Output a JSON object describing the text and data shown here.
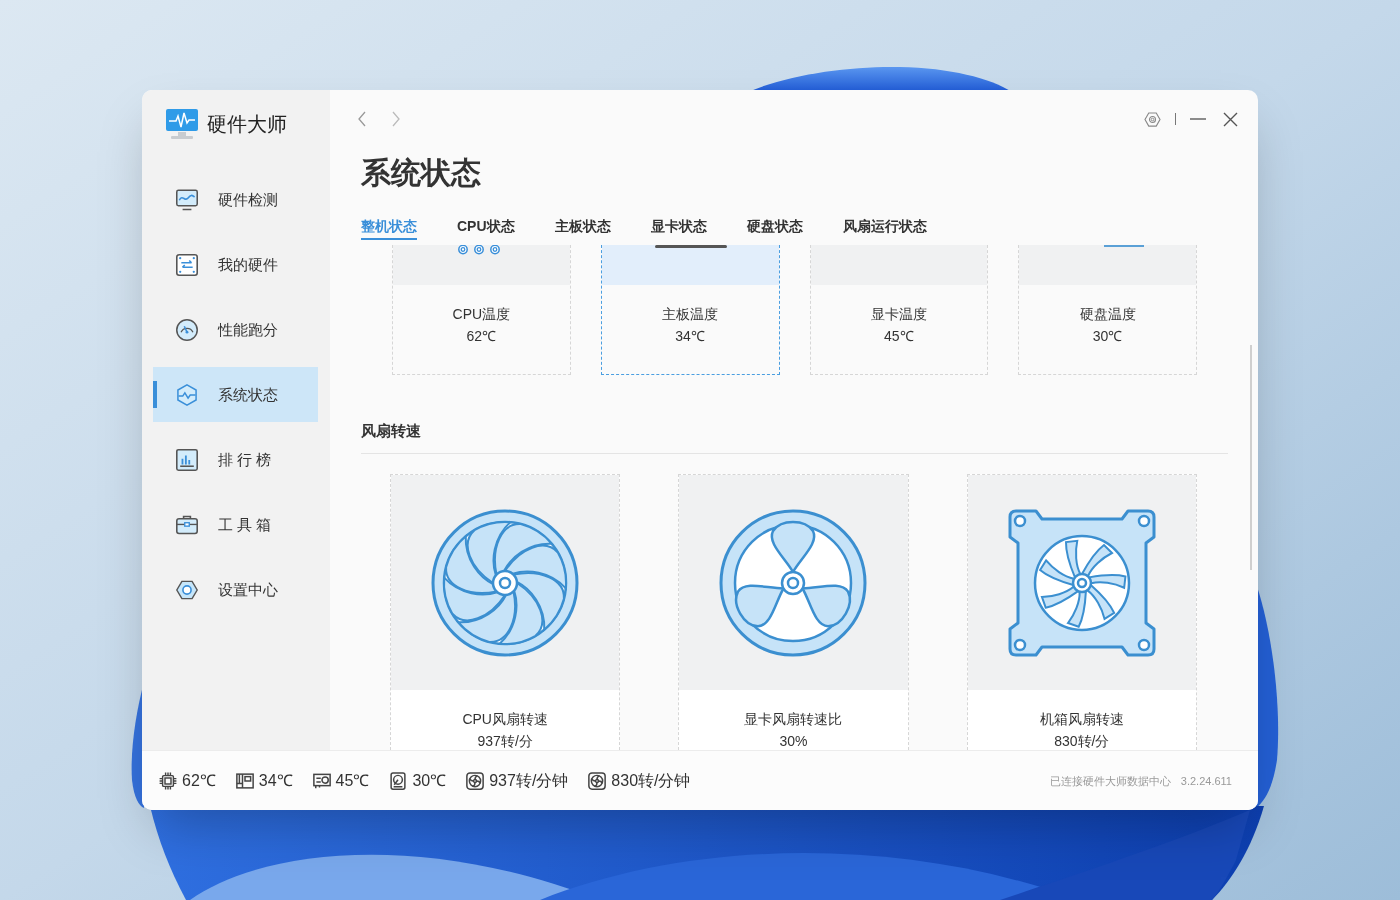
{
  "app": {
    "title": "硬件大师"
  },
  "sidebar": {
    "items": [
      {
        "label": "硬件检测",
        "kind": "monitor",
        "selected": false
      },
      {
        "label": "我的硬件",
        "kind": "board",
        "selected": false
      },
      {
        "label": "性能跑分",
        "kind": "gauge",
        "selected": false
      },
      {
        "label": "系统状态",
        "kind": "pulse",
        "selected": true
      },
      {
        "label": "排 行 榜",
        "kind": "chart",
        "selected": false
      },
      {
        "label": "工 具 箱",
        "kind": "toolbox",
        "selected": false
      },
      {
        "label": "设置中心",
        "kind": "nut",
        "selected": false
      }
    ]
  },
  "page": {
    "title": "系统状态"
  },
  "tabs": [
    {
      "label": "整机状态",
      "selected": true
    },
    {
      "label": "CPU状态",
      "selected": false
    },
    {
      "label": "主板状态",
      "selected": false
    },
    {
      "label": "显卡状态",
      "selected": false
    },
    {
      "label": "硬盘状态",
      "selected": false
    },
    {
      "label": "风扇运行状态",
      "selected": false
    }
  ],
  "temperature_cards": [
    {
      "label": "CPU温度",
      "value": "62℃",
      "kind": "rings",
      "selected": false
    },
    {
      "label": "主板温度",
      "value": "34℃",
      "kind": "bar",
      "selected": true
    },
    {
      "label": "显卡温度",
      "value": "45℃",
      "kind": "plain",
      "selected": false
    },
    {
      "label": "硬盘温度",
      "value": "30℃",
      "kind": "line",
      "selected": false
    }
  ],
  "fan_section": {
    "title": "风扇转速",
    "cards": [
      {
        "label": "CPU风扇转速",
        "value": "937转/分",
        "kind": "cpu_fan"
      },
      {
        "label": "显卡风扇转速比",
        "value": "30%",
        "kind": "gpu_fan"
      },
      {
        "label": "机箱风扇转速",
        "value": "830转/分",
        "kind": "case_fan"
      }
    ]
  },
  "status_bar": {
    "readings": [
      {
        "kind": "cpu",
        "value": "62℃"
      },
      {
        "kind": "board",
        "value": "34℃"
      },
      {
        "kind": "gpu",
        "value": "45℃"
      },
      {
        "kind": "disk",
        "value": "30℃"
      },
      {
        "kind": "fan",
        "value": "937转/分钟"
      },
      {
        "kind": "fan",
        "value": "830转/分钟"
      }
    ],
    "connection": "已连接硬件大师数据中心",
    "version": "3.2.24.611"
  }
}
